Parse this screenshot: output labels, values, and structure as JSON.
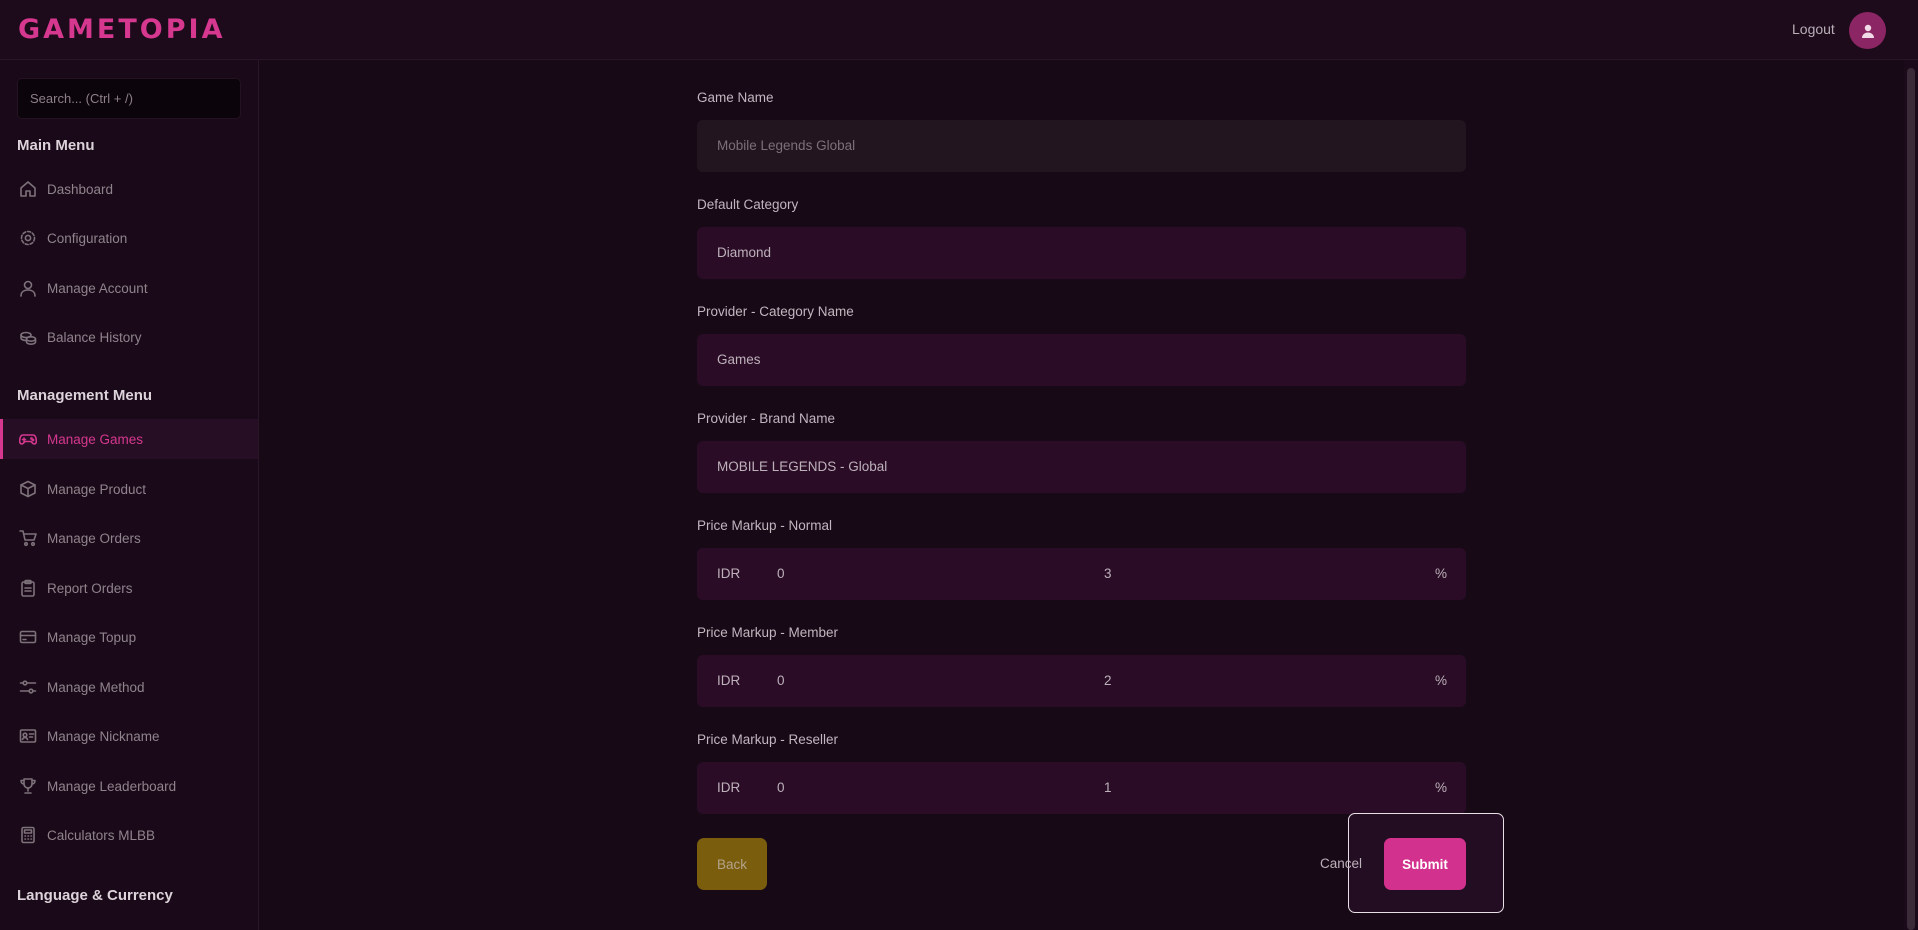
{
  "app": {
    "logo": "GAMETOPIA"
  },
  "header": {
    "logout": "Logout",
    "avatar_icon": "user-icon"
  },
  "sidebar": {
    "search_placeholder": "Search... (Ctrl + /)",
    "main_menu_title": "Main Menu",
    "main_menu": [
      {
        "label": "Dashboard",
        "icon": "home-icon"
      },
      {
        "label": "Configuration",
        "icon": "gear-icon"
      },
      {
        "label": "Manage Account",
        "icon": "user-icon"
      },
      {
        "label": "Balance History",
        "icon": "coins-icon"
      }
    ],
    "management_menu_title": "Management Menu",
    "management_menu": [
      {
        "label": "Manage Games",
        "icon": "gamepad-icon",
        "active": true
      },
      {
        "label": "Manage Product",
        "icon": "box-icon"
      },
      {
        "label": "Manage Orders",
        "icon": "cart-icon"
      },
      {
        "label": "Report Orders",
        "icon": "clipboard-icon"
      },
      {
        "label": "Manage Topup",
        "icon": "card-icon"
      },
      {
        "label": "Manage Method",
        "icon": "sliders-icon"
      },
      {
        "label": "Manage Nickname",
        "icon": "id-card-icon"
      },
      {
        "label": "Manage Leaderboard",
        "icon": "trophy-icon"
      },
      {
        "label": "Calculators MLBB",
        "icon": "calculator-icon"
      }
    ],
    "language_title": "Language & Currency"
  },
  "form": {
    "game_name": {
      "label": "Game Name",
      "value": "Mobile Legends Global"
    },
    "default_category": {
      "label": "Default Category",
      "value": "Diamond"
    },
    "provider_category": {
      "label": "Provider - Category Name",
      "value": "Games"
    },
    "provider_brand": {
      "label": "Provider - Brand Name",
      "value": "MOBILE LEGENDS - Global"
    },
    "markup_normal": {
      "label": "Price Markup - Normal",
      "currency": "IDR",
      "fixed": "0",
      "percent": "3",
      "unit": "%"
    },
    "markup_member": {
      "label": "Price Markup - Member",
      "currency": "IDR",
      "fixed": "0",
      "percent": "2",
      "unit": "%"
    },
    "markup_reseller": {
      "label": "Price Markup - Reseller",
      "currency": "IDR",
      "fixed": "0",
      "percent": "1",
      "unit": "%"
    },
    "back": "Back",
    "cancel": "Cancel",
    "submit": "Submit"
  },
  "colors": {
    "accent": "#d6378f",
    "background": "#170916",
    "back_button": "#7b5d0e"
  }
}
